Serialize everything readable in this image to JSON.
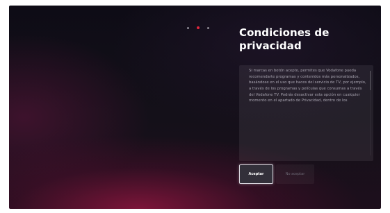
{
  "pager": {
    "total": 3,
    "active_index": 1,
    "active_color": "#e0263c"
  },
  "title": "Condiciones de privacidad",
  "body_text": "Si marcas en botón acepto, permites que Vodafone pueda recomendarte programas y contenidos más personalizados, basándose en el uso que haces del servicio de TV, por ejemplo, a través de los programas y películas que consumas a través del Vodafone TV. Podrás desactivar esta opción en cualquier momento en el apartado de Privacidad, dentro de los",
  "buttons": {
    "accept_label": "Aceptar",
    "reject_label": "No aceptar"
  },
  "colors": {
    "background": "#141019",
    "accent": "#e0263c",
    "title": "#ffffff"
  }
}
